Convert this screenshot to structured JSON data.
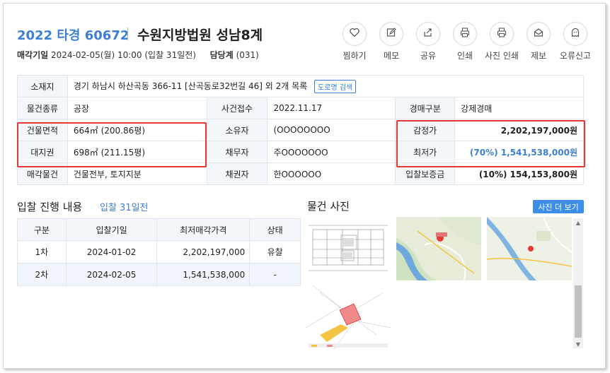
{
  "header": {
    "case_no": "2022 타경 60672",
    "court": "수원지방법원 성남8계",
    "sale_date_label": "매각기일",
    "sale_date_value": "2024-02-05(월) 10:00 (입찰 31일전)",
    "dept_label": "담당계",
    "dept_value": "(031)"
  },
  "tools": [
    {
      "label": "찜하기",
      "icon": "heart-icon"
    },
    {
      "label": "메모",
      "icon": "pencil-icon"
    },
    {
      "label": "공유",
      "icon": "share-icon"
    },
    {
      "label": "인쇄",
      "icon": "printer-icon"
    },
    {
      "label": "사진 인쇄",
      "icon": "printer-icon"
    },
    {
      "label": "제보",
      "icon": "envelope-icon"
    },
    {
      "label": "오류신고",
      "icon": "ghost-icon"
    }
  ],
  "info": {
    "location_label": "소재지",
    "location_value": "경기 하남시 하산곡동 366-11 [산곡동로32번길 46] 외 2개 목록",
    "road_search": "도로명 검색",
    "type_label": "물건종류",
    "type_value": "공장",
    "received_label": "사건접수",
    "received_value": "2022.11.17",
    "auction_type_label": "경매구분",
    "auction_type_value": "강제경매",
    "building_label": "건물면적",
    "building_value": "664㎡ (200.86평)",
    "owner_label": "소유자",
    "owner_value": "(OOOOOOOO",
    "appraisal_label": "감정가",
    "appraisal_value": "2,202,197,000원",
    "land_label": "대지권",
    "land_value": "698㎡ (211.15평)",
    "debtor_label": "채무자",
    "debtor_value": "주OOOOOOO",
    "min_label": "최저가",
    "min_value": "(70%) 1,541,538,000원",
    "sale_item_label": "매각물건",
    "sale_item_value": "건물전부, 토지지분",
    "creditor_label": "채권자",
    "creditor_value": "한OOOOOO",
    "deposit_label": "입찰보증금",
    "deposit_value": "(10%) 154,153,800원"
  },
  "bidding": {
    "title": "입찰 진행 내용",
    "subtitle": "입찰 31일전",
    "columns": [
      "구분",
      "입찰기일",
      "최저매각가격",
      "상태"
    ],
    "rows": [
      [
        "1차",
        "2024-01-02",
        "2,202,197,000",
        "유찰"
      ],
      [
        "2차",
        "2024-02-05",
        "1,541,538,000",
        "-"
      ]
    ]
  },
  "photos": {
    "title": "물건 사진",
    "more": "사진 더 보기"
  },
  "colors": {
    "accent": "#3d7fd4",
    "highlight_box": "#e53935",
    "header_cell": "#f3f6fa"
  }
}
